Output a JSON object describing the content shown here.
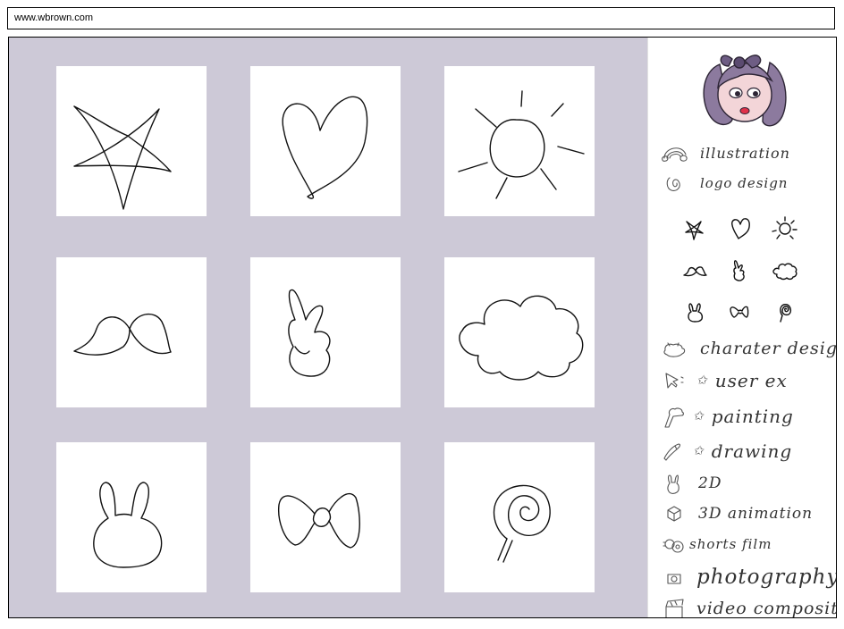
{
  "browser": {
    "url": "www.wbrown.com"
  },
  "gallery": {
    "tiles": [
      {
        "icon": "star-doodle"
      },
      {
        "icon": "heart-doodle"
      },
      {
        "icon": "sun-doodle"
      },
      {
        "icon": "mustache-doodle"
      },
      {
        "icon": "peace-hand-doodle"
      },
      {
        "icon": "cloud-doodle"
      },
      {
        "icon": "bunny-doodle"
      },
      {
        "icon": "bow-doodle"
      },
      {
        "icon": "lollipop-doodle"
      }
    ]
  },
  "sidebar": {
    "avatar": "girl-with-bow-avatar",
    "nav_top": [
      {
        "label": "illustration",
        "icon": "rainbow-icon"
      },
      {
        "label": "logo design",
        "icon": "logo-swirl-icon"
      }
    ],
    "thumbnails": [
      "star-icon",
      "heart-icon",
      "sun-icon",
      "mustache-icon",
      "peace-hand-icon",
      "cloud-icon",
      "bunny-icon",
      "bow-icon",
      "lollipop-icon"
    ],
    "nav_bottom": [
      {
        "label": "charater design",
        "icon": "creature-icon"
      },
      {
        "label": "user ex",
        "icon": "cursor-icon"
      },
      {
        "label": "painting",
        "icon": "paintbrush-icon"
      },
      {
        "label": "drawing",
        "icon": "pencil-icon"
      },
      {
        "label": "2D",
        "icon": "bunny-small-icon"
      },
      {
        "label": "3D animation",
        "icon": "cube-icon"
      },
      {
        "label": "shorts film",
        "icon": "film-reel-icon"
      },
      {
        "label": "photography",
        "icon": "camera-icon"
      },
      {
        "label": "video compositing",
        "icon": "clapperboard-icon"
      }
    ]
  }
}
